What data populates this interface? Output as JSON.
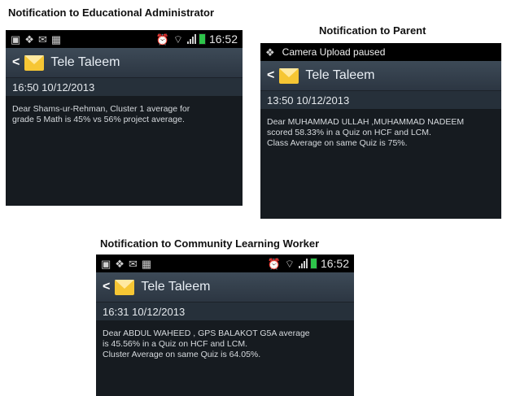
{
  "captions": {
    "admin": "Notification to Educational Administrator",
    "parent": "Notification to Parent",
    "worker": "Notification to Community Learning Worker"
  },
  "admin_screen": {
    "status_time": "16:52",
    "app_title": "Tele Taleem",
    "datetime": "16:50  10/12/2013",
    "message_lines": [
      "Dear Shams-ur-Rehman, Cluster 1 average for",
      "grade 5 Math is 45% vs 56% project average."
    ]
  },
  "parent_screen": {
    "status_text": "Camera Upload paused",
    "app_title": "Tele Taleem",
    "datetime": "13:50  10/12/2013",
    "message_lines": [
      "Dear MUHAMMAD ULLAH ,MUHAMMAD NADEEM",
      "scored 58.33%  in a Quiz on HCF and LCM.",
      "Class Average on same Quiz is 75%."
    ]
  },
  "worker_screen": {
    "status_time": "16:52",
    "app_title": "Tele Taleem",
    "datetime": "16:31  10/12/2013",
    "message_lines": [
      "Dear ABDUL WAHEED , GPS BALAKOT G5A average",
      "is 45.56%  in a Quiz on HCF and LCM.",
      "Cluster Average on same Quiz is 64.05%."
    ]
  },
  "icons": {
    "status_left": [
      "picture-icon",
      "dropbox-icon",
      "mail-icon",
      "calendar-icon"
    ],
    "status_right": [
      "alarm-icon",
      "wifi-icon",
      "signal-icon",
      "battery-icon"
    ],
    "app": "envelope-icon",
    "back": "back-chevron-icon"
  },
  "colors": {
    "screen_bg": "#161b20",
    "status_bg": "#000000",
    "appbar_bg": "#36414d",
    "date_bg": "#26303a",
    "battery": "#2ec44a",
    "envelope": "#f6c634"
  }
}
